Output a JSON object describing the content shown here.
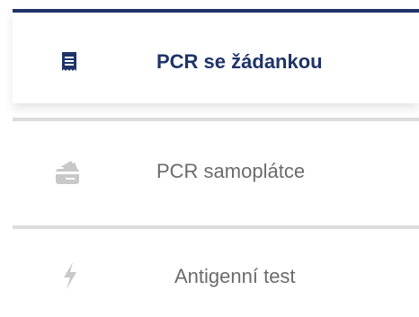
{
  "tabs": [
    {
      "label": "PCR se žádankou",
      "icon": "receipt-icon",
      "state": "active"
    },
    {
      "label": "PCR samoplátce",
      "icon": "wallet-card-icon",
      "state": "inactive"
    },
    {
      "label": "Antigenní test",
      "icon": "lightning-icon",
      "state": "inactive"
    }
  ],
  "colors": {
    "accent": "#1e3468",
    "inactive_text": "#6b6b6b",
    "inactive_icon": "#c8c8c8",
    "divider": "#dcdcdc"
  }
}
